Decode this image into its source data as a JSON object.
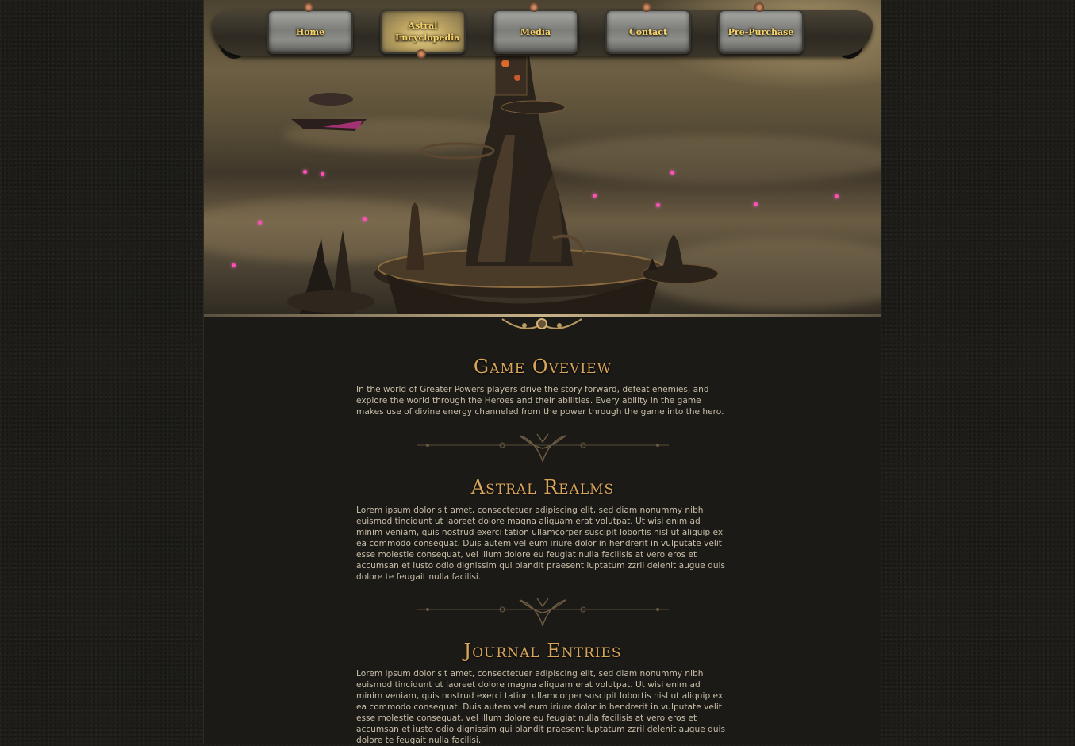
{
  "nav": {
    "items": [
      {
        "label": "Home"
      },
      {
        "label": "Astral Encyclopedia",
        "active": true
      },
      {
        "label": "Media"
      },
      {
        "label": "Contact"
      },
      {
        "label": "Pre-Purchase"
      }
    ]
  },
  "hero": {
    "image": "steampunk-floating-city-illustration"
  },
  "sections": [
    {
      "title": "Game Oveview",
      "body": "In the world of Greater Powers players drive the story forward, defeat enemies, and explore the world through the Heroes and their abilities. Every ability in the game makes use of divine energy channeled from the power through the game into the hero."
    },
    {
      "title": "Astral Realms",
      "body": "Lorem ipsum dolor sit amet, consectetuer adipiscing elit, sed diam nonummy nibh euismod tincidunt ut laoreet dolore magna aliquam erat volutpat. Ut wisi enim ad minim veniam, quis nostrud exerci tation ullamcorper suscipit lobortis nisl ut aliquip ex ea commodo consequat. Duis autem vel eum iriure dolor in hendrerit in vulputate velit esse molestie consequat, vel illum dolore eu feugiat nulla facilisis at vero eros et accumsan et iusto odio dignissim qui blandit praesent luptatum zzril delenit augue duis dolore te feugait nulla facilisi."
    },
    {
      "title": "Journal Entries",
      "body": "Lorem ipsum dolor sit amet, consectetuer adipiscing elit, sed diam nonummy nibh euismod tincidunt ut laoreet dolore magna aliquam erat volutpat. Ut wisi enim ad minim veniam, quis nostrud exerci tation ullamcorper suscipit lobortis nisl ut aliquip ex ea commodo consequat. Duis autem vel eum iriure dolor in hendrerit in vulputate velit esse molestie consequat, vel illum dolore eu feugiat nulla facilisis at vero eros et accumsan et iusto odio dignissim qui blandit praesent luptatum zzril delenit augue duis dolore te feugait nulla facilisi."
    }
  ],
  "colors": {
    "accent": "#d9a55a",
    "nav_text": "#f6d46a",
    "body_text": "#c9bfa8",
    "background": "#1b1a17"
  }
}
